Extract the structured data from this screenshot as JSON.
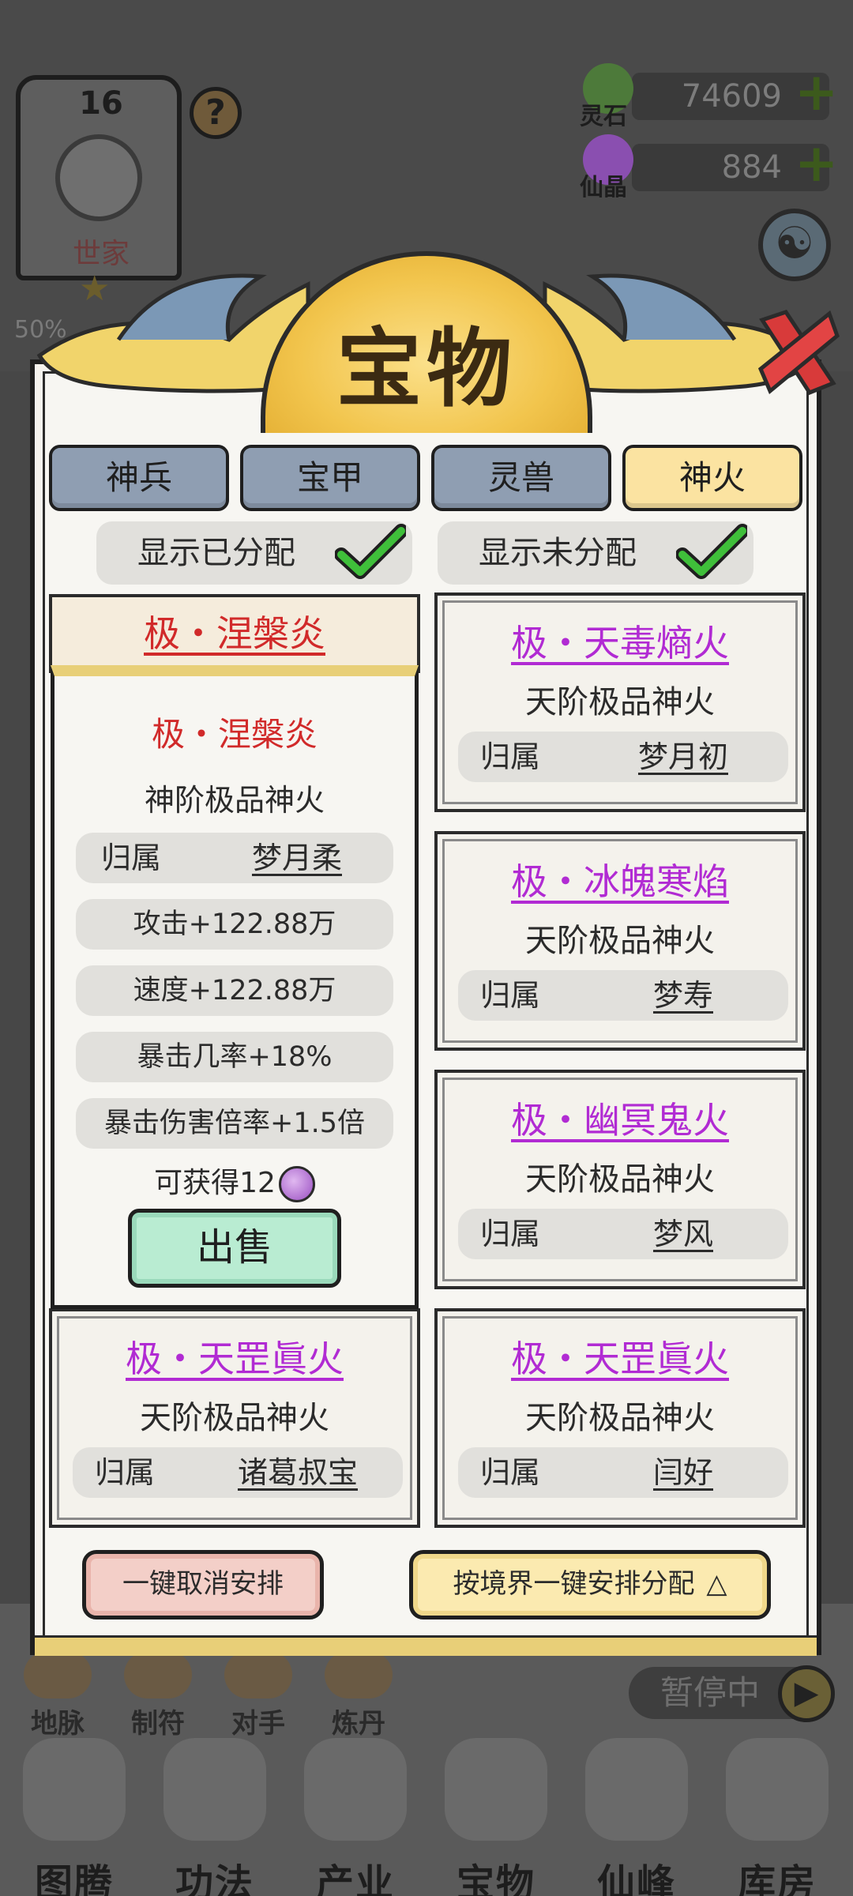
{
  "hud": {
    "level": "16",
    "family": "世家",
    "help": "?",
    "progress_text": "50%",
    "resources": [
      {
        "label": "灵石",
        "value": "74609",
        "color": "#4d7a3a"
      },
      {
        "label": "仙晶",
        "value": "884",
        "color": "#8a4fb0"
      }
    ]
  },
  "modal": {
    "title": "宝物",
    "tabs": [
      {
        "label": "神兵",
        "active": false
      },
      {
        "label": "宝甲",
        "active": false
      },
      {
        "label": "灵兽",
        "active": false
      },
      {
        "label": "神火",
        "active": true
      }
    ],
    "filters": [
      {
        "label": "显示已分配",
        "checked": true
      },
      {
        "label": "显示未分配",
        "checked": true
      }
    ],
    "selected": {
      "header": "极・涅槃炎",
      "name": "极・涅槃炎",
      "grade": "神阶极品神火",
      "owner_key": "归属",
      "owner": "梦月柔",
      "stats": [
        "攻击+122.88万",
        "速度+122.88万",
        "暴击几率+18%",
        "暴击伤害倍率+1.5倍"
      ],
      "gain_text": "可获得12",
      "sell_label": "出售"
    },
    "items": [
      {
        "name": "极・天毒熵火",
        "grade": "天阶极品神火",
        "owner_key": "归属",
        "owner": "梦月初"
      },
      {
        "name": "极・冰魄寒焰",
        "grade": "天阶极品神火",
        "owner_key": "归属",
        "owner": "梦寿"
      },
      {
        "name": "极・幽冥鬼火",
        "grade": "天阶极品神火",
        "owner_key": "归属",
        "owner": "梦风"
      },
      {
        "name": "极・天罡眞火",
        "grade": "天阶极品神火",
        "owner_key": "归属",
        "owner": "诸葛叔宝"
      },
      {
        "name": "极・天罡眞火",
        "grade": "天阶极品神火",
        "owner_key": "归属",
        "owner": "闫好"
      }
    ],
    "actions": {
      "cancel_all": "一键取消安排",
      "assign_all": "按境界一键安排分配"
    }
  },
  "side_menu": [
    "地脉",
    "制符",
    "对手",
    "炼丹"
  ],
  "pause": {
    "label": "暂停中"
  },
  "bottom_nav": [
    "图腾",
    "功法",
    "产业",
    "宝物",
    "仙峰",
    "库房"
  ],
  "colors": {
    "accent_gold": "#f2c54d",
    "tab_active": "#fbe3a1",
    "tab_inactive": "#8f9eb2",
    "item_name": "#b12bd3",
    "selected_name": "#d12a2a",
    "sell_button": "#b9ecd2"
  }
}
